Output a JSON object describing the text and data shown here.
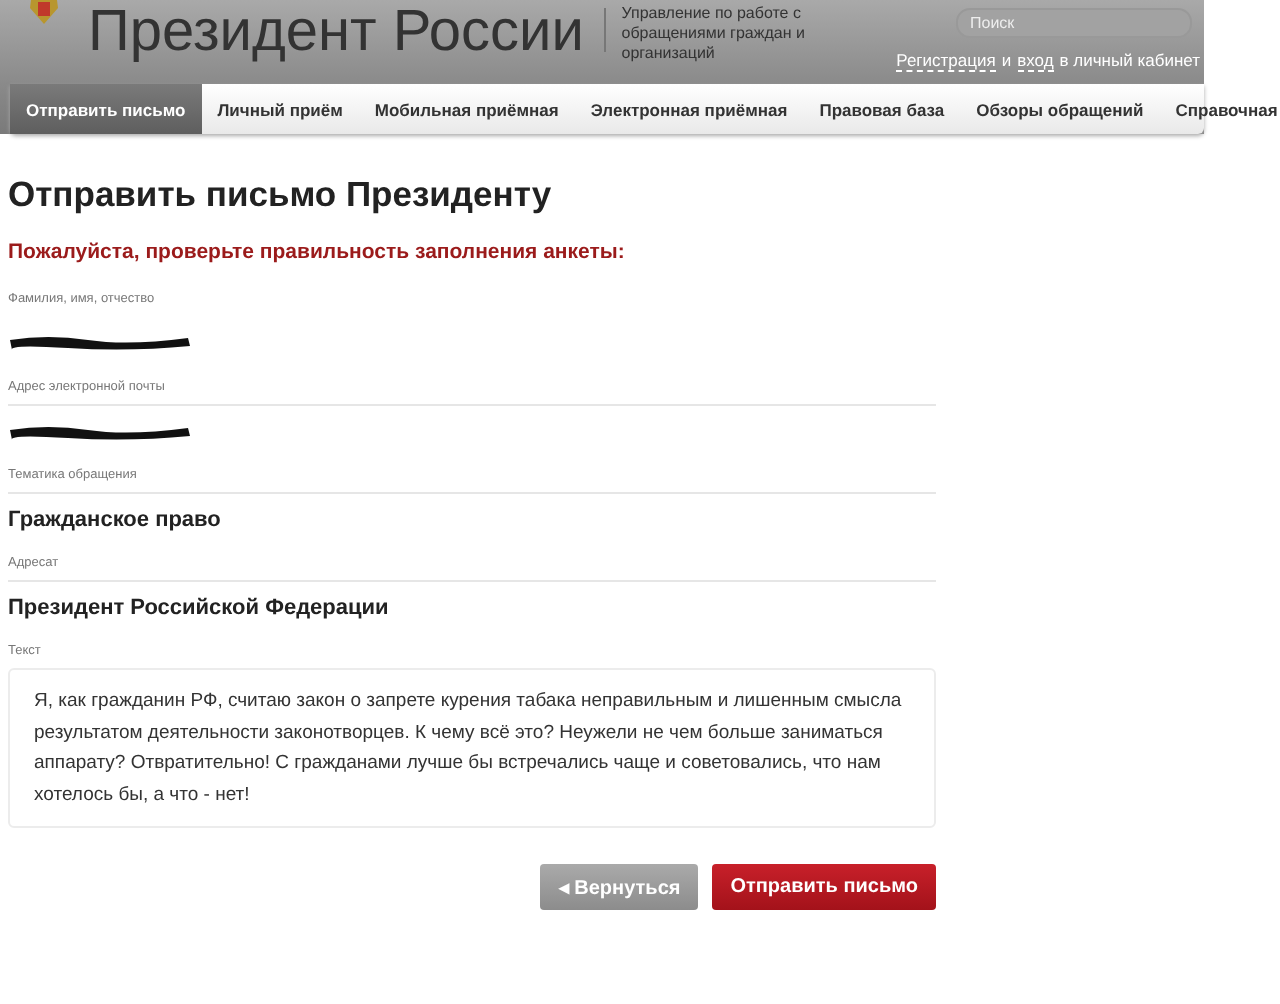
{
  "header": {
    "site_title": "Президент России",
    "subtitle": "Управление по работе с обращениями граждан и организаций",
    "search": {
      "placeholder": "Поиск"
    },
    "account_link": {
      "parts": [
        "Регистрация",
        "и",
        "вход",
        "в личный кабинет"
      ]
    }
  },
  "nav": [
    {
      "label": "Отправить письмо",
      "selected": true
    },
    {
      "label": "Личный приём",
      "selected": false
    },
    {
      "label": "Мобильная приёмная",
      "selected": false
    },
    {
      "label": "Электронная приёмная",
      "selected": false
    },
    {
      "label": "Правовая база",
      "selected": false
    },
    {
      "label": "Обзоры обращений",
      "selected": false
    },
    {
      "label": "Справочная",
      "selected": false
    }
  ],
  "page_title": "Отправить письмо Президенту",
  "notice": "Пожалуйста, проверьте правильность заполнения анкеты:",
  "fields": [
    {
      "label": "Фамилия, имя, отчество",
      "kind": "redacted"
    },
    {
      "label": "Адрес электронной почты",
      "kind": "redacted"
    },
    {
      "label": "Тематика обращения",
      "kind": "text",
      "value": "Гражданское право"
    },
    {
      "label": "Адресат",
      "kind": "text",
      "value": "Президент Российской Федерации"
    },
    {
      "label": "Текст",
      "kind": "message",
      "value": "Я, как гражданин РФ, считаю закон о запрете курения табака неправильным и лишенным смысла результатом деятельности законотворцев. К чему всё это? Неужели не чем больше заниматься аппарату? Отвратительно! С гражданами лучше бы встречались чаще и советовались, что нам хотелось бы, а что - нет!"
    }
  ],
  "buttons": [
    {
      "label": "◂ Вернуться",
      "kind": "back"
    },
    {
      "label": "Отправить письмо",
      "kind": "submit"
    }
  ]
}
